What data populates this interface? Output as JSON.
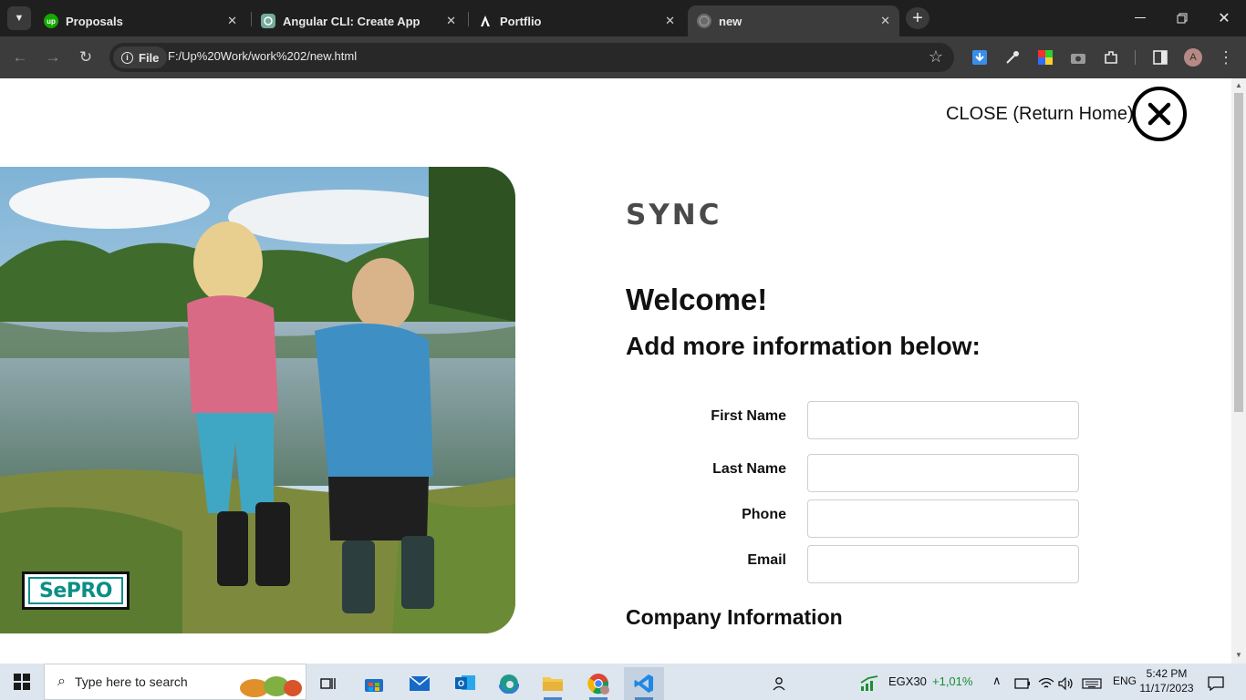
{
  "browser": {
    "tabs": [
      {
        "title": "Proposals",
        "favicon": "upwork-icon"
      },
      {
        "title": "Angular CLI: Create App",
        "favicon": "chatgpt-icon"
      },
      {
        "title": "Portflio",
        "favicon": "angular-icon"
      },
      {
        "title": "new",
        "favicon": "globe-icon"
      }
    ],
    "address": {
      "chip_label": "File",
      "url": "F:/Up%20Work/work%202/new.html"
    },
    "profile_initial": "A",
    "upwork_favicon_text": "up"
  },
  "page": {
    "close_label": "CLOSE (Return Home)",
    "brand": "SYNC",
    "welcome": "Welcome!",
    "subtitle": "Add more information below:",
    "form": {
      "fields": [
        {
          "label": "First Name",
          "value": ""
        },
        {
          "label": "Last Name",
          "value": ""
        },
        {
          "label": "Phone",
          "value": ""
        },
        {
          "label": "Email",
          "value": ""
        }
      ]
    },
    "section_title": "Company Information",
    "photo_logo": "SePRO"
  },
  "taskbar": {
    "search_placeholder": "Type here to search",
    "stock": {
      "symbol": "EGX30",
      "change": "+1,01%",
      "change_color": "#1a8f2e"
    },
    "language": "ENG",
    "time": "5:42 PM",
    "date": "11/17/2023"
  },
  "colors": {
    "chrome_dark": "#1f1f1f",
    "toolbar": "#3c3c3c",
    "brand_text": "#4a4a4a",
    "logo_teal": "#0a8f86"
  }
}
